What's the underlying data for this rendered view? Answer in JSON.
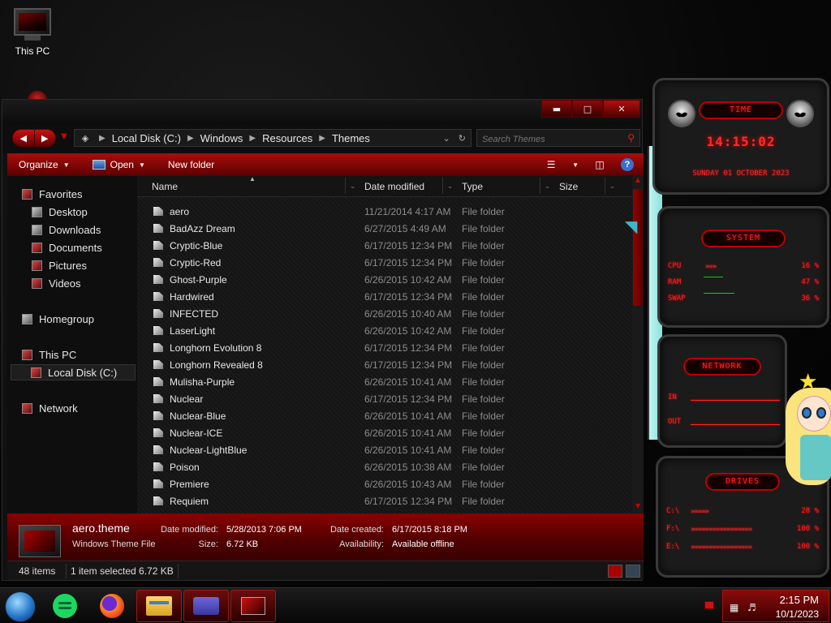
{
  "desktop": {
    "icons": [
      {
        "label": "This PC",
        "icon": "monitor-icon"
      }
    ]
  },
  "explorer": {
    "caption_buttons": [
      "minimize",
      "maximize",
      "close"
    ],
    "breadcrumbs": [
      "Local Disk (C:)",
      "Windows",
      "Resources",
      "Themes"
    ],
    "search_placeholder": "Search Themes",
    "toolbar": {
      "organize": "Organize",
      "open": "Open",
      "new_folder": "New folder"
    },
    "nav": {
      "favorites": "Favorites",
      "desktop": "Desktop",
      "downloads": "Downloads",
      "documents": "Documents",
      "pictures": "Pictures",
      "videos": "Videos",
      "homegroup": "Homegroup",
      "this_pc": "This PC",
      "local_disk": "Local Disk (C:)",
      "network": "Network"
    },
    "columns": {
      "name": "Name",
      "date": "Date modified",
      "type": "Type",
      "size": "Size"
    },
    "files": [
      {
        "name": "aero",
        "date": "11/21/2014 4:17 AM",
        "type": "File folder"
      },
      {
        "name": "BadAzz Dream",
        "date": "6/27/2015 4:49 AM",
        "type": "File folder"
      },
      {
        "name": "Cryptic-Blue",
        "date": "6/17/2015 12:34 PM",
        "type": "File folder"
      },
      {
        "name": "Cryptic-Red",
        "date": "6/17/2015 12:34 PM",
        "type": "File folder"
      },
      {
        "name": "Ghost-Purple",
        "date": "6/26/2015 10:42 AM",
        "type": "File folder"
      },
      {
        "name": "Hardwired",
        "date": "6/17/2015 12:34 PM",
        "type": "File folder"
      },
      {
        "name": "INFECTED",
        "date": "6/26/2015 10:40 AM",
        "type": "File folder"
      },
      {
        "name": "LaserLight",
        "date": "6/26/2015 10:42 AM",
        "type": "File folder"
      },
      {
        "name": "Longhorn Evolution 8",
        "date": "6/17/2015 12:34 PM",
        "type": "File folder"
      },
      {
        "name": "Longhorn Revealed 8",
        "date": "6/17/2015 12:34 PM",
        "type": "File folder"
      },
      {
        "name": "Mulisha-Purple",
        "date": "6/26/2015 10:41 AM",
        "type": "File folder"
      },
      {
        "name": "Nuclear",
        "date": "6/17/2015 12:34 PM",
        "type": "File folder"
      },
      {
        "name": "Nuclear-Blue",
        "date": "6/26/2015 10:41 AM",
        "type": "File folder"
      },
      {
        "name": "Nuclear-ICE",
        "date": "6/26/2015 10:41 AM",
        "type": "File folder"
      },
      {
        "name": "Nuclear-LightBlue",
        "date": "6/26/2015 10:41 AM",
        "type": "File folder"
      },
      {
        "name": "Poison",
        "date": "6/26/2015 10:38 AM",
        "type": "File folder"
      },
      {
        "name": "Premiere",
        "date": "6/26/2015 10:43 AM",
        "type": "File folder"
      },
      {
        "name": "Requiem",
        "date": "6/17/2015 12:34 PM",
        "type": "File folder"
      }
    ],
    "details": {
      "file_name": "aero.theme",
      "file_type": "Windows Theme File",
      "date_modified_label": "Date modified:",
      "date_modified": "5/28/2013 7:06 PM",
      "size_label": "Size:",
      "size": "6.72 KB",
      "date_created_label": "Date created:",
      "date_created": "6/17/2015 8:18 PM",
      "availability_label": "Availability:",
      "availability": "Available offline"
    },
    "status": {
      "count": "48 items",
      "selection": "1 item selected  6.72 KB"
    }
  },
  "gadgets": {
    "time": {
      "title": "TIME",
      "clock": "14:15:02",
      "date": "SUNDAY 01 OCTOBER 2023"
    },
    "system": {
      "title": "SYSTEM",
      "rows": [
        {
          "key": "CPU",
          "bar": "»»»",
          "value": "16 %"
        },
        {
          "key": "RAM",
          "bar": "",
          "value": "47 %"
        },
        {
          "key": "SWAP",
          "bar": "",
          "value": "36 %"
        }
      ]
    },
    "network": {
      "title": "NETWORK",
      "in_label": "IN",
      "out_label": "OUT"
    },
    "drives": {
      "title": "DRIVES",
      "rows": [
        {
          "key": "C:\\",
          "bar": "»»»»»",
          "value": "28 %"
        },
        {
          "key": "F:\\",
          "bar": "»»»»»»»»»»»»»»»»»",
          "value": "100 %"
        },
        {
          "key": "E:\\",
          "bar": "»»»»»»»»»»»»»»»»»",
          "value": "100 %"
        }
      ]
    }
  },
  "taskbar": {
    "apps": [
      "spotify-icon",
      "firefox-icon",
      "file-explorer-icon",
      "card-app-icon",
      "theme-app-icon"
    ],
    "time": "2:15 PM",
    "date": "10/1/2023"
  },
  "colors": {
    "accent": "#a80d0d",
    "accent_dark": "#3a0000",
    "gadget_red": "#ff2a2a"
  }
}
